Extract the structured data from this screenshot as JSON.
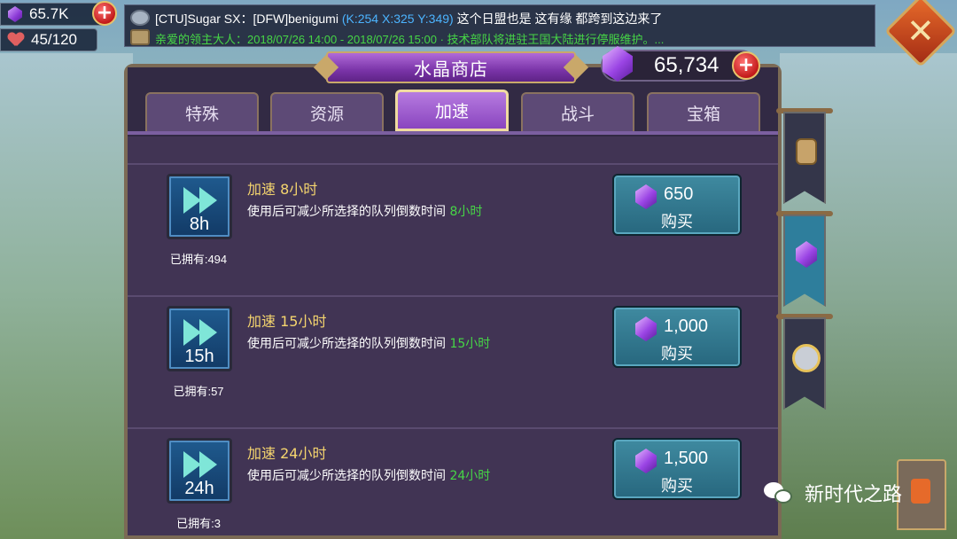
{
  "resources": {
    "gems": "65.7K",
    "stamina": "45/120"
  },
  "chat": {
    "line1_prefix": "[CTU]Sugar SX：[DFW]benigumi ",
    "line1_coords": "(K:254 X:325 Y:349)",
    "line1_suffix": " 这个日盟也是  这有缘 都跨到这边来了",
    "line2": "亲爱的领主大人：2018/07/26 14:00 - 2018/07/26 15:00 · 技术部队将进驻王国大陆进行停服维护。..."
  },
  "shop": {
    "title": "水晶商店",
    "balance": "65,734",
    "tabs": [
      {
        "label": "特殊"
      },
      {
        "label": "资源"
      },
      {
        "label": "加速"
      },
      {
        "label": "战斗"
      },
      {
        "label": "宝箱"
      }
    ],
    "active_tab": "加速",
    "items": [
      {
        "hours": "8h",
        "owned": "已拥有:494",
        "name": "加速 8小时",
        "desc": "使用后可减少所选择的队列倒数时间 ",
        "desc_highlight": "8小时",
        "price": "650",
        "buy_label": "购买"
      },
      {
        "hours": "15h",
        "owned": "已拥有:57",
        "name": "加速 15小时",
        "desc": "使用后可减少所选择的队列倒数时间 ",
        "desc_highlight": "15小时",
        "price": "1,000",
        "buy_label": "购买"
      },
      {
        "hours": "24h",
        "owned": "已拥有:3",
        "name": "加速 24小时",
        "desc": "使用后可减少所选择的队列倒数时间 ",
        "desc_highlight": "24小时",
        "price": "1,500",
        "buy_label": "购买"
      }
    ]
  },
  "watermark": "新时代之路",
  "icons": {
    "close": "close-icon",
    "gem": "gem-icon",
    "heart": "heart-icon",
    "plus": "plus-icon",
    "speedup": "speedup-arrows-icon"
  },
  "colors": {
    "accent_gold": "#f5d56e",
    "highlight_green": "#46d646",
    "coords_blue": "#4cb4ff",
    "buy_button": "#3f8aa0",
    "active_tab": "#8a45bf"
  }
}
